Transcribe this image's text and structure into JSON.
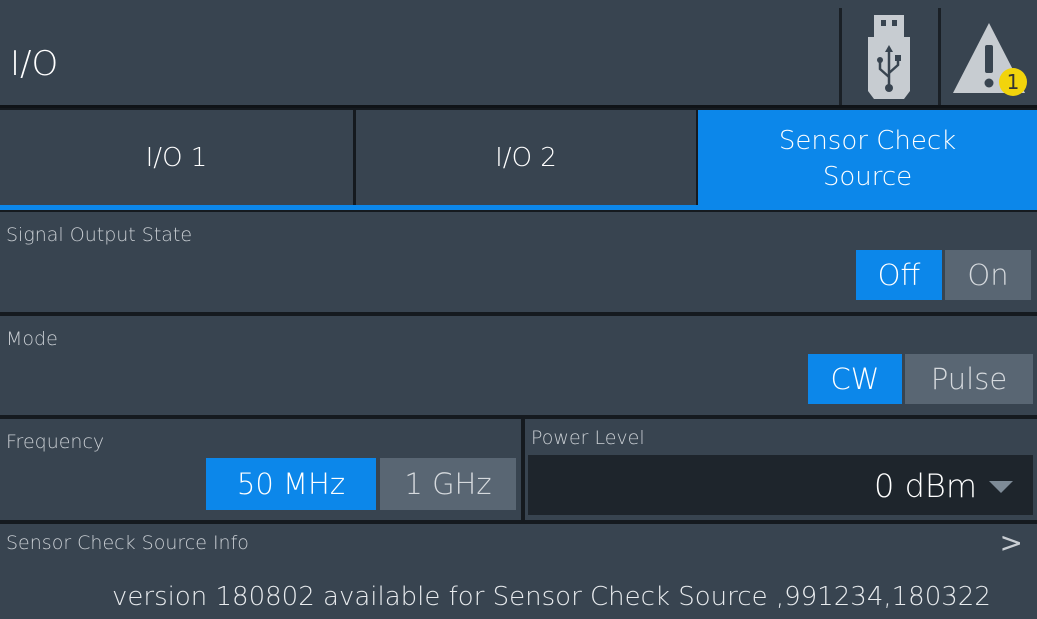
{
  "header": {
    "title": "I/O",
    "usb_icon": "usb-stick-icon",
    "warning_icon": "warning-triangle-icon",
    "warning_count": "1"
  },
  "tabs": [
    {
      "label": "I/O 1"
    },
    {
      "label": "I/O 2"
    },
    {
      "label": "Sensor Check Source",
      "line1": "Sensor Check",
      "line2": "Source",
      "active": true
    }
  ],
  "signal_output": {
    "label": "Signal Output State",
    "options": [
      "Off",
      "On"
    ],
    "selected": "Off"
  },
  "mode": {
    "label": "Mode",
    "options": [
      "CW",
      "Pulse"
    ],
    "selected": "CW"
  },
  "frequency": {
    "label": "Frequency",
    "options": [
      "50 MHz",
      "1 GHz"
    ],
    "selected": "50 MHz"
  },
  "power_level": {
    "label": "Power Level",
    "value": "0 dBm"
  },
  "info": {
    "label": "Sensor Check Source Info",
    "chevron": ">",
    "text": "version 180802 available for Sensor Check Source ,991234,180322"
  },
  "colors": {
    "accent": "#0c87ea",
    "panel": "#384450",
    "badge": "#f2d40c"
  }
}
